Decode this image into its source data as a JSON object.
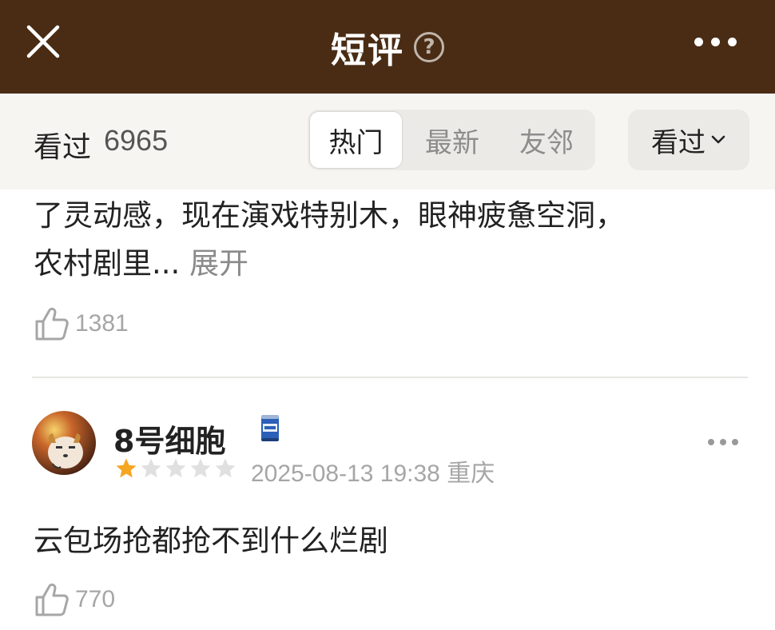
{
  "header": {
    "title": "短评",
    "help_symbol": "?"
  },
  "filter": {
    "watched_label": "看过",
    "watched_count": "6965",
    "tabs": [
      {
        "label": "热门",
        "active": true
      },
      {
        "label": "最新",
        "active": false
      },
      {
        "label": "友邻",
        "active": false
      }
    ],
    "status_select": "看过"
  },
  "reviews": [
    {
      "text_lines": [
        "了灵动感，现在演戏特别木，眼神疲惫空洞，",
        "农村剧里..."
      ],
      "expand_label": "展开",
      "likes": "1381"
    },
    {
      "username": "8号细胞",
      "rating_stars": 1,
      "rating_max": 5,
      "date": "2025-08-13 19:38",
      "location": "重庆",
      "text": "云包场抢都抢不到什么烂剧",
      "likes": "770"
    }
  ],
  "colors": {
    "header_bg": "#4a2c14",
    "filter_bg": "#f7f5f2",
    "star_filled": "#f5a623",
    "star_empty": "#e0e0e0",
    "muted_text": "#a6a6a6"
  },
  "icons": {
    "close": "close-icon",
    "help": "help-icon",
    "more": "more-icon",
    "like": "thumbs-up-icon",
    "dropdown": "chevron-down-icon",
    "badge": "can-badge-icon"
  }
}
